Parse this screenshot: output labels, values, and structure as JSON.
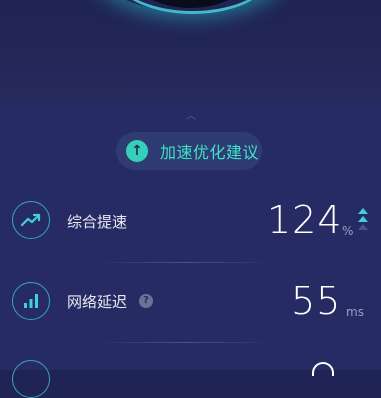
{
  "suggestion": {
    "label": "加速优化建议",
    "icon": "arrow-up-circle-icon"
  },
  "metrics": [
    {
      "label": "综合提速",
      "value": "124",
      "unit": "%",
      "icon": "trend-up-icon"
    },
    {
      "label": "网络延迟",
      "value": "55",
      "unit": "ms",
      "icon": "signal-bars-icon"
    }
  ],
  "colors": {
    "accent": "#3fe3c6",
    "panel": "#272b63",
    "ring": "#3aa4b8"
  }
}
